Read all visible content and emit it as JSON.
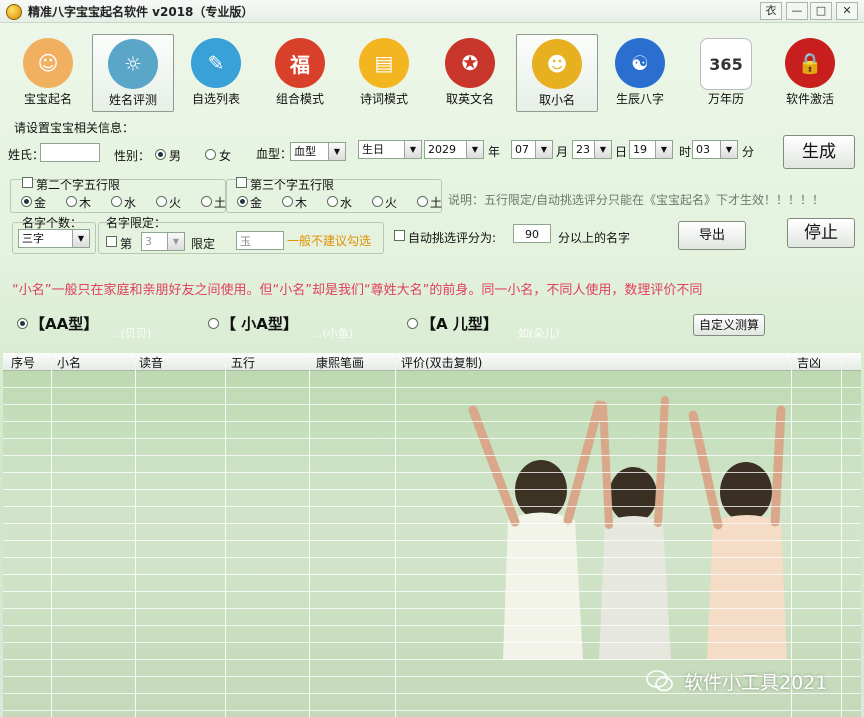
{
  "window": {
    "title": "精准八字宝宝起名软件 v2018（专业版）",
    "controls": [
      "衣",
      "—",
      "□",
      "✕"
    ]
  },
  "toolbar": {
    "items": [
      {
        "label": "宝宝起名",
        "color": "#f0b060",
        "glyph": "☺"
      },
      {
        "label": "姓名评测",
        "color": "#5aa6c8",
        "glyph": "☼",
        "active": true
      },
      {
        "label": "自选列表",
        "color": "#3aa0d8",
        "glyph": "✎"
      },
      {
        "label": "组合模式",
        "color": "#d9402a",
        "glyph": "福"
      },
      {
        "label": "诗词模式",
        "color": "#f3b520",
        "glyph": "▤"
      },
      {
        "label": "取英文名",
        "color": "#c8352b",
        "glyph": "✪"
      },
      {
        "label": "取小名",
        "color": "#e6b020",
        "glyph": "☻",
        "active": true
      },
      {
        "label": "生辰八字",
        "color": "#2a6fd0",
        "glyph": "☯"
      },
      {
        "label": "万年历",
        "color": "#ffffff",
        "glyph": "365"
      },
      {
        "label": "软件激活",
        "color": "#c81e1e",
        "glyph": "🔒"
      }
    ]
  },
  "form": {
    "section_label": "请设置宝宝相关信息：",
    "surname_label": "姓氏：",
    "surname_value": "",
    "gender_label": "性别：",
    "gender_male": "男",
    "gender_female": "女",
    "blood_label": "血型：",
    "blood_value": "血型",
    "birthday_value": "生日",
    "year_value": "2029",
    "year_label": "年",
    "month_value": "07",
    "month_label": "月",
    "day_value": "23",
    "day_label": "日",
    "hour_value": "19",
    "hour_label": "时",
    "minute_value": "03",
    "minute_label": "分",
    "generate_button": "生成",
    "second_char_label": "第二个字五行限",
    "third_char_label": "第三个字五行限",
    "elements": [
      "金",
      "木",
      "水",
      "火",
      "土"
    ],
    "note": "说明：五行限定/自动挑选评分只能在《宝宝起名》下才生效！！！！！",
    "name_count_label": "名字个数：",
    "name_count_value": "三字",
    "name_limit_label": "名字限定：",
    "limit_nth_label": "第",
    "limit_nth_value": "3",
    "limit_label": "限定",
    "limit_char_value": "玉",
    "limit_hint": "一般不建议勾选",
    "auto_score_label": "自动挑选评分为:",
    "auto_score_value": "90",
    "auto_score_suffix": "分以上的名字",
    "export_button": "导出",
    "stop_button": "停止"
  },
  "info_line": "“小名”一般只在家庭和亲朋好友之间使用。但“小名”却是我们“尊姓大名”的前身。同一小名，不同人使用，数理评价不同",
  "name_types": [
    {
      "title": "【AA型】",
      "example": "...(贝贝)",
      "selected": true
    },
    {
      "title": "【 小A型】",
      "example": "...(小鱼)",
      "selected": false
    },
    {
      "title": "【A 儿型】",
      "example": "如(朵儿)",
      "selected": false
    }
  ],
  "custom_calc_button": "自定义测算",
  "table": {
    "columns": [
      "序号",
      "小名",
      "读音",
      "五行",
      "康熙笔画",
      "评价(双击复制)",
      "吉凶"
    ]
  },
  "watermark": "软件小工具2021"
}
